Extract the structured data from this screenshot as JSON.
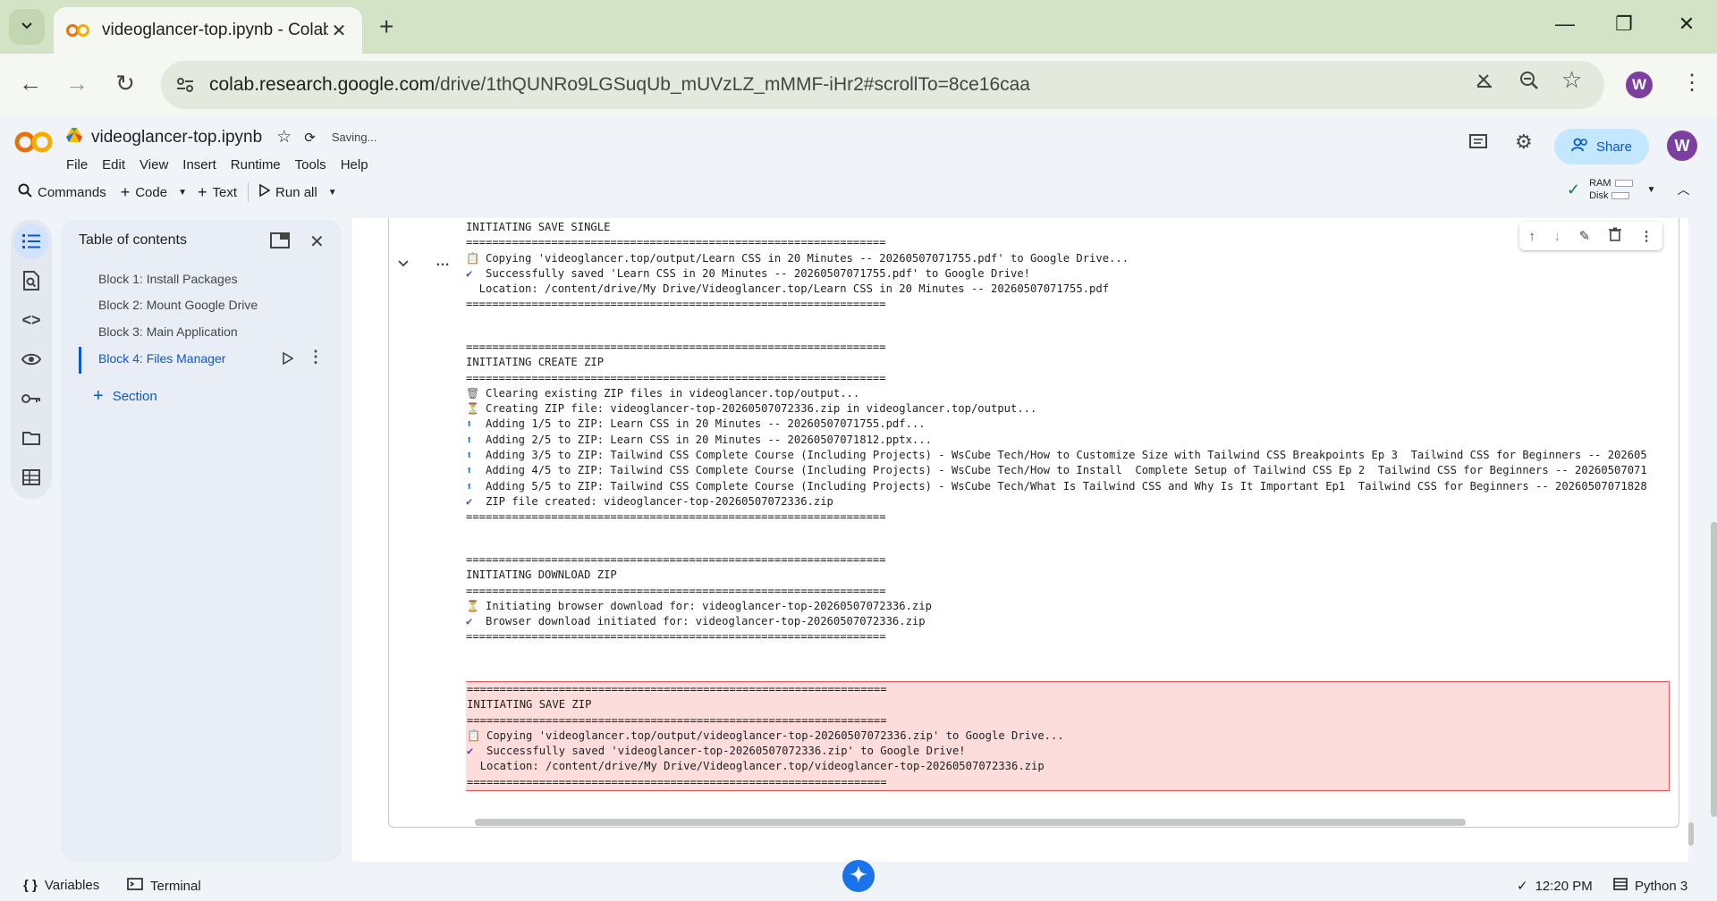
{
  "browser": {
    "tab_title": "videoglancer-top.ipynb - Colab",
    "url_domain": "colab.research.google.com",
    "url_path": "/drive/1thQUNRo9LGSuqUb_mUVzLZ_mMMF-iHr2#scrollTo=8ce16caa",
    "profile_initial": "W"
  },
  "colab": {
    "notebook_name": "videoglancer-top.ipynb",
    "saving_status": "Saving...",
    "menu": [
      "File",
      "Edit",
      "View",
      "Insert",
      "Runtime",
      "Tools",
      "Help"
    ],
    "toolbar": {
      "commands": "Commands",
      "code": "Code",
      "text": "Text",
      "run_all": "Run all"
    },
    "share_label": "Share",
    "profile_initial": "W",
    "ram_label": "RAM",
    "disk_label": "Disk"
  },
  "toc": {
    "title": "Table of contents",
    "items": [
      {
        "label": "Block 1: Install Packages"
      },
      {
        "label": "Block 2: Mount Google Drive"
      },
      {
        "label": "Block 3: Main Application"
      },
      {
        "label": "Block 4: Files Manager"
      }
    ],
    "section_label": "Section"
  },
  "output": {
    "block1": [
      {
        "icon": "",
        "text": "INITIATING SAVE SINGLE"
      },
      {
        "icon": "",
        "text": "================================================================"
      },
      {
        "icon": "📋",
        "text": "Copying 'videoglancer.top/output/Learn CSS in 20 Minutes -- 20260507071755.pdf' to Google Drive..."
      },
      {
        "icon": "✔",
        "text": "Successfully saved 'Learn CSS in 20 Minutes -- 20260507071755.pdf' to Google Drive!"
      },
      {
        "icon": "",
        "text": "  Location: /content/drive/My Drive/Videoglancer.top/Learn CSS in 20 Minutes -- 20260507071755.pdf"
      },
      {
        "icon": "",
        "text": "================================================================"
      }
    ],
    "block2": [
      {
        "icon": "",
        "text": "================================================================"
      },
      {
        "icon": "",
        "text": "INITIATING CREATE ZIP"
      },
      {
        "icon": "",
        "text": "================================================================"
      },
      {
        "icon": "🗑",
        "text": "Clearing existing ZIP files in videoglancer.top/output..."
      },
      {
        "icon": "⏳",
        "text": "Creating ZIP file: videoglancer-top-20260507072336.zip in videoglancer.top/output..."
      },
      {
        "icon": "⬆",
        "text": "Adding 1/5 to ZIP: Learn CSS in 20 Minutes -- 20260507071755.pdf..."
      },
      {
        "icon": "⬆",
        "text": "Adding 2/5 to ZIP: Learn CSS in 20 Minutes -- 20260507071812.pptx..."
      },
      {
        "icon": "⬆",
        "text": "Adding 3/5 to ZIP: Tailwind CSS Complete Course (Including Projects) - WsCube Tech/How to Customize Size with Tailwind CSS Breakpoints Ep 3  Tailwind CSS for Beginners -- 202605"
      },
      {
        "icon": "⬆",
        "text": "Adding 4/5 to ZIP: Tailwind CSS Complete Course (Including Projects) - WsCube Tech/How to Install  Complete Setup of Tailwind CSS Ep 2  Tailwind CSS for Beginners -- 20260507071"
      },
      {
        "icon": "⬆",
        "text": "Adding 5/5 to ZIP: Tailwind CSS Complete Course (Including Projects) - WsCube Tech/What Is Tailwind CSS and Why Is It Important Ep1  Tailwind CSS for Beginners -- 20260507071828"
      },
      {
        "icon": "✔",
        "text": "ZIP file created: videoglancer-top-20260507072336.zip"
      },
      {
        "icon": "",
        "text": "================================================================"
      }
    ],
    "block3": [
      {
        "icon": "",
        "text": "================================================================"
      },
      {
        "icon": "",
        "text": "INITIATING DOWNLOAD ZIP"
      },
      {
        "icon": "",
        "text": "================================================================"
      },
      {
        "icon": "⏳",
        "text": "Initiating browser download for: videoglancer-top-20260507072336.zip"
      },
      {
        "icon": "✔",
        "text": "Browser download initiated for: videoglancer-top-20260507072336.zip"
      },
      {
        "icon": "",
        "text": "================================================================"
      }
    ],
    "block4": [
      {
        "icon": "",
        "text": "================================================================"
      },
      {
        "icon": "",
        "text": "INITIATING SAVE ZIP"
      },
      {
        "icon": "",
        "text": "================================================================"
      },
      {
        "icon": "📋",
        "text": "Copying 'videoglancer.top/output/videoglancer-top-20260507072336.zip' to Google Drive..."
      },
      {
        "icon": "✔",
        "text": "Successfully saved 'videoglancer-top-20260507072336.zip' to Google Drive!"
      },
      {
        "icon": "",
        "text": "  Location: /content/drive/My Drive/Videoglancer.top/videoglancer-top-20260507072336.zip"
      },
      {
        "icon": "",
        "text": "================================================================"
      }
    ]
  },
  "statusbar": {
    "variables": "Variables",
    "terminal": "Terminal",
    "time": "12:20 PM",
    "runtime": "Python 3"
  }
}
